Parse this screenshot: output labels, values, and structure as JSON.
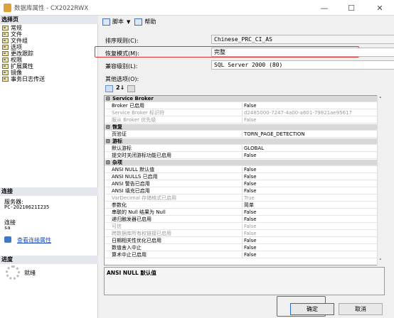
{
  "window": {
    "title": "数据库属性 - CX2022RWX",
    "minimize_glyph": "—",
    "maximize_glyph": "☐",
    "close_glyph": "✕"
  },
  "left": {
    "select_page_header": "选择页",
    "pages": [
      "常规",
      "文件",
      "文件组",
      "选项",
      "更改跟踪",
      "权限",
      "扩展属性",
      "镜像",
      "事务日志传送"
    ],
    "connection_header": "连接",
    "server_label": "服务器:",
    "server_value": "PC-20210621I235",
    "connect_label": "连接",
    "connect_value": "sa",
    "view_connection_link": "查看连接属性",
    "progress_header": "进度",
    "progress_status": "就绪"
  },
  "toolbar": {
    "script_label": "脚本",
    "help_label": "帮助"
  },
  "form": {
    "collation_label": "排序规则(C):",
    "collation_value": "Chinese_PRC_CI_AS",
    "recovery_label": "恢复模式(M):",
    "recovery_value": "完整",
    "compat_label": "兼容级别(L):",
    "compat_value": "SQL Server 2000 (80)",
    "other_options_label": "其他选项(O):"
  },
  "grid": {
    "rows": [
      {
        "kind": "cat",
        "name": "Service Broker",
        "value": ""
      },
      {
        "kind": "row",
        "name": "Broker 已启用",
        "value": "False"
      },
      {
        "kind": "gray",
        "name": "Service Broker 标识符",
        "value": "d2485000-7247-4a00-a601-79821ae95617"
      },
      {
        "kind": "gray",
        "name": "服从 Broker 优先级",
        "value": "False"
      },
      {
        "kind": "cat",
        "name": "恢复",
        "value": ""
      },
      {
        "kind": "row",
        "name": "页验证",
        "value": "TORN_PAGE_DETECTION"
      },
      {
        "kind": "cat",
        "name": "游标",
        "value": ""
      },
      {
        "kind": "row",
        "name": "默认游标",
        "value": "GLOBAL"
      },
      {
        "kind": "row",
        "name": "提交时关闭游标功能已启用",
        "value": "False"
      },
      {
        "kind": "cat",
        "name": "杂项",
        "value": ""
      },
      {
        "kind": "row",
        "name": "ANSI NULL 默认值",
        "value": "False"
      },
      {
        "kind": "row",
        "name": "ANSI NULLS 已启用",
        "value": "False"
      },
      {
        "kind": "row",
        "name": "ANSI 警告已启用",
        "value": "False"
      },
      {
        "kind": "row",
        "name": "ANSI 填充已启用",
        "value": "False"
      },
      {
        "kind": "gray",
        "name": "VarDecimal 存储格式已启用",
        "value": "True"
      },
      {
        "kind": "row",
        "name": "参数化",
        "value": "简单"
      },
      {
        "kind": "row",
        "name": "串联的 Null 结果为 Null",
        "value": "False"
      },
      {
        "kind": "row",
        "name": "递归触发器已启用",
        "value": "False"
      },
      {
        "kind": "gray",
        "name": "可信",
        "value": "False"
      },
      {
        "kind": "gray",
        "name": "跨数据库所有权链接已启用",
        "value": "False"
      },
      {
        "kind": "row",
        "name": "日期相关性优化已启用",
        "value": "False"
      },
      {
        "kind": "row",
        "name": "数值舍入中止",
        "value": "False"
      },
      {
        "kind": "row",
        "name": "算术中止已启用",
        "value": "False"
      }
    ],
    "description": "ANSI NULL 默认值"
  },
  "buttons": {
    "ok": "确定",
    "cancel": "取消"
  },
  "colors": {
    "highlight_red": "#e03030"
  }
}
